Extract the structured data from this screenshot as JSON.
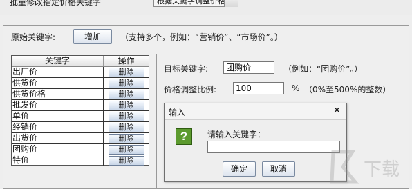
{
  "top": {
    "label": "批量修改指定价格关键字",
    "combo_value": "根据关键字调整价格"
  },
  "source": {
    "label": "原始关键字:",
    "add_label": "增加",
    "hint": "（支持多个，例如：“营销价”、“市场价”。）"
  },
  "table": {
    "headers": [
      "关键字",
      "操作"
    ],
    "delete_label": "删除",
    "rows": [
      "出厂价",
      "供货价",
      "供货价格",
      "批发价",
      "单价",
      "经销价",
      "出货价",
      "团购价",
      "特价"
    ]
  },
  "target": {
    "label": "目标关键字:",
    "value": "团购价",
    "hint": "（例如：“团购价”。）"
  },
  "ratio": {
    "label": "价格调整比例:",
    "value": "100",
    "unit": "%",
    "hint": "（0%至500%的整数）"
  },
  "dialog": {
    "title": "输入",
    "close_glyph": "✕",
    "prompt": "请输入关键字：",
    "input_value": "",
    "ok_label": "确定",
    "cancel_label": "取消",
    "icon_glyph": "?"
  },
  "watermark": "下载"
}
